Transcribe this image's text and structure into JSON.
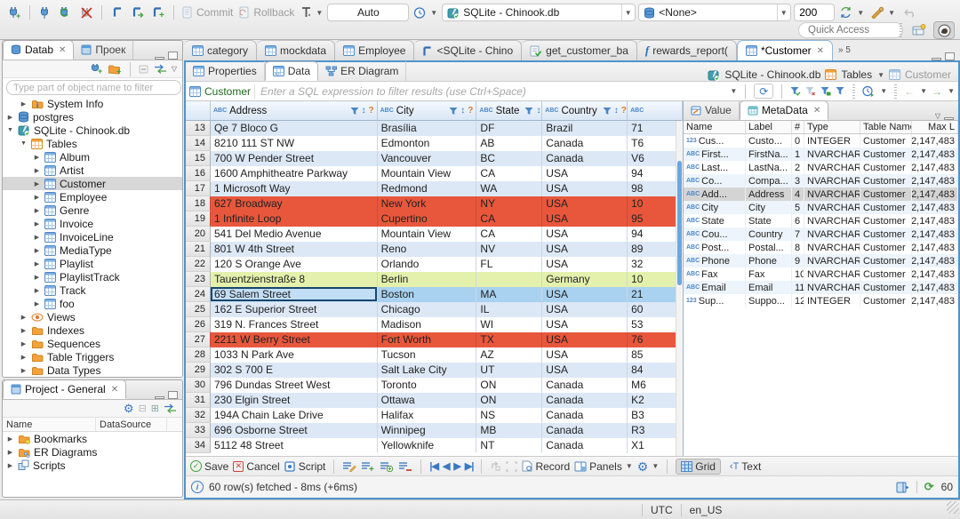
{
  "colors": {
    "accent": "#4f94cd",
    "row_alt": "#dce8f6",
    "row_error": "#e8573c",
    "row_modified": "#e4f1ad",
    "row_selected": "#a9d2f0",
    "header_blue": "#d9e7f6"
  },
  "toolbar": {
    "commit_label": "Commit",
    "rollback_label": "Rollback",
    "txn_mode": "Auto",
    "connection": "SQLite - Chinook.db",
    "schema": "<None>",
    "fetch_size": "200",
    "quick_access_placeholder": "Quick Access"
  },
  "sidebar": {
    "db_tab_label": "Datab",
    "project_tab_label": "Проек",
    "filter_placeholder": "Type part of object name to filter",
    "tree": [
      {
        "label": "System Info",
        "icon": "folder-info",
        "level": 1,
        "expand": "collapsed"
      },
      {
        "label": "postgres",
        "icon": "database",
        "level": 0,
        "expand": "collapsed"
      },
      {
        "label": "SQLite - Chinook.db",
        "icon": "sqlite-db",
        "level": 0,
        "expand": "expanded"
      },
      {
        "label": "Tables",
        "icon": "tables-folder",
        "level": 1,
        "expand": "expanded"
      },
      {
        "label": "Album",
        "icon": "table",
        "level": 2,
        "expand": "collapsed"
      },
      {
        "label": "Artist",
        "icon": "table",
        "level": 2,
        "expand": "collapsed"
      },
      {
        "label": "Customer",
        "icon": "table",
        "level": 2,
        "expand": "collapsed",
        "selected": true
      },
      {
        "label": "Employee",
        "icon": "table",
        "level": 2,
        "expand": "collapsed"
      },
      {
        "label": "Genre",
        "icon": "table",
        "level": 2,
        "expand": "collapsed"
      },
      {
        "label": "Invoice",
        "icon": "table",
        "level": 2,
        "expand": "collapsed"
      },
      {
        "label": "InvoiceLine",
        "icon": "table",
        "level": 2,
        "expand": "collapsed"
      },
      {
        "label": "MediaType",
        "icon": "table",
        "level": 2,
        "expand": "collapsed"
      },
      {
        "label": "Playlist",
        "icon": "table",
        "level": 2,
        "expand": "collapsed"
      },
      {
        "label": "PlaylistTrack",
        "icon": "table",
        "level": 2,
        "expand": "collapsed"
      },
      {
        "label": "Track",
        "icon": "table",
        "level": 2,
        "expand": "collapsed"
      },
      {
        "label": "foo",
        "icon": "table",
        "level": 2,
        "expand": "collapsed"
      },
      {
        "label": "Views",
        "icon": "views",
        "level": 1,
        "expand": "collapsed"
      },
      {
        "label": "Indexes",
        "icon": "folder",
        "level": 1,
        "expand": "collapsed"
      },
      {
        "label": "Sequences",
        "icon": "folder",
        "level": 1,
        "expand": "collapsed"
      },
      {
        "label": "Table Triggers",
        "icon": "folder",
        "level": 1,
        "expand": "collapsed"
      },
      {
        "label": "Data Types",
        "icon": "folder",
        "level": 1,
        "expand": "collapsed"
      }
    ],
    "project_panel": {
      "title": "Project - General",
      "columns": [
        "Name",
        "DataSource"
      ],
      "items": [
        {
          "label": "Bookmarks",
          "icon": "bookmarks-folder"
        },
        {
          "label": "ER Diagrams",
          "icon": "er-folder"
        },
        {
          "label": "Scripts",
          "icon": "scripts"
        }
      ]
    }
  },
  "editor": {
    "tabs": [
      {
        "label": "category",
        "icon": "table"
      },
      {
        "label": "mockdata",
        "icon": "table"
      },
      {
        "label": "Employee",
        "icon": "table"
      },
      {
        "label": "<SQLite - Chino",
        "icon": "sql"
      },
      {
        "label": "get_customer_ba",
        "icon": "script-check"
      },
      {
        "label": "rewards_report(",
        "icon": "function"
      },
      {
        "label": "*Customer",
        "icon": "table",
        "active": true,
        "closable": true
      }
    ],
    "tab_overflow": "5",
    "subtabs": [
      {
        "label": "Properties",
        "icon": "table"
      },
      {
        "label": "Data",
        "icon": "data-grid",
        "active": true
      },
      {
        "label": "ER Diagram",
        "icon": "diagram"
      }
    ],
    "breadcrumb": {
      "connection": "SQLite - Chinook.db",
      "container": "Tables",
      "entity": "Customer"
    },
    "filter": {
      "entity": "Customer",
      "placeholder": "Enter a SQL expression to filter results (use Ctrl+Space)"
    },
    "grid": {
      "columns": [
        {
          "label": "Address",
          "kind": "ABC"
        },
        {
          "label": "City",
          "kind": "ABC"
        },
        {
          "label": "State",
          "kind": "ABC"
        },
        {
          "label": "Country",
          "kind": "ABC"
        },
        {
          "label": "",
          "kind": "ABC"
        }
      ],
      "rows": [
        {
          "num": "13",
          "address": "Qe 7 Bloco G",
          "city": "Brasília",
          "state": "DF",
          "country": "Brazil",
          "postal": "71",
          "style": "alt"
        },
        {
          "num": "14",
          "address": "8210 111 ST NW",
          "city": "Edmonton",
          "state": "AB",
          "country": "Canada",
          "postal": "T6",
          "style": "plain"
        },
        {
          "num": "15",
          "address": "700 W Pender Street",
          "city": "Vancouver",
          "state": "BC",
          "country": "Canada",
          "postal": "V6",
          "style": "alt"
        },
        {
          "num": "16",
          "address": "1600 Amphitheatre Parkway",
          "city": "Mountain View",
          "state": "CA",
          "country": "USA",
          "postal": "94",
          "style": "plain"
        },
        {
          "num": "17",
          "address": "1 Microsoft Way",
          "city": "Redmond",
          "state": "WA",
          "country": "USA",
          "postal": "98",
          "style": "alt"
        },
        {
          "num": "18",
          "address": "627 Broadway",
          "city": "New York",
          "state": "NY",
          "country": "USA",
          "postal": "10",
          "style": "red"
        },
        {
          "num": "19",
          "address": "1 Infinite Loop",
          "city": "Cupertino",
          "state": "CA",
          "country": "USA",
          "postal": "95",
          "style": "red"
        },
        {
          "num": "20",
          "address": "541 Del Medio Avenue",
          "city": "Mountain View",
          "state": "CA",
          "country": "USA",
          "postal": "94",
          "style": "plain"
        },
        {
          "num": "21",
          "address": "801 W 4th Street",
          "city": "Reno",
          "state": "NV",
          "country": "USA",
          "postal": "89",
          "style": "alt"
        },
        {
          "num": "22",
          "address": "120 S Orange Ave",
          "city": "Orlando",
          "state": "FL",
          "country": "USA",
          "postal": "32",
          "style": "plain"
        },
        {
          "num": "23",
          "address": "Tauentzienstraße 8",
          "city": "Berlin",
          "state": "",
          "country": "Germany",
          "postal": "10",
          "style": "green"
        },
        {
          "num": "24",
          "address": "69 Salem Street",
          "city": "Boston",
          "state": "MA",
          "country": "USA",
          "postal": "21",
          "style": "selected"
        },
        {
          "num": "25",
          "address": "162 E Superior Street",
          "city": "Chicago",
          "state": "IL",
          "country": "USA",
          "postal": "60",
          "style": "alt"
        },
        {
          "num": "26",
          "address": "319 N. Frances Street",
          "city": "Madison",
          "state": "WI",
          "country": "USA",
          "postal": "53",
          "style": "plain"
        },
        {
          "num": "27",
          "address": "2211 W Berry Street",
          "city": "Fort Worth",
          "state": "TX",
          "country": "USA",
          "postal": "76",
          "style": "red"
        },
        {
          "num": "28",
          "address": "1033 N Park Ave",
          "city": "Tucson",
          "state": "AZ",
          "country": "USA",
          "postal": "85",
          "style": "plain"
        },
        {
          "num": "29",
          "address": "302 S 700 E",
          "city": "Salt Lake City",
          "state": "UT",
          "country": "USA",
          "postal": "84",
          "style": "alt"
        },
        {
          "num": "30",
          "address": "796 Dundas Street West",
          "city": "Toronto",
          "state": "ON",
          "country": "Canada",
          "postal": "M6",
          "style": "plain"
        },
        {
          "num": "31",
          "address": "230 Elgin Street",
          "city": "Ottawa",
          "state": "ON",
          "country": "Canada",
          "postal": "K2",
          "style": "alt"
        },
        {
          "num": "32",
          "address": "194A Chain Lake Drive",
          "city": "Halifax",
          "state": "NS",
          "country": "Canada",
          "postal": "B3",
          "style": "plain"
        },
        {
          "num": "33",
          "address": "696 Osborne Street",
          "city": "Winnipeg",
          "state": "MB",
          "country": "Canada",
          "postal": "R3",
          "style": "alt"
        },
        {
          "num": "34",
          "address": "5112 48 Street",
          "city": "Yellowknife",
          "state": "NT",
          "country": "Canada",
          "postal": "X1",
          "style": "plain"
        }
      ]
    },
    "panel": {
      "value_tab": "Value",
      "metadata_tab": "MetaData",
      "columns": [
        "Name",
        "Label",
        "#",
        "Type",
        "Table Name",
        "Max L"
      ],
      "rows": [
        {
          "kind": "123",
          "name": "Cus...",
          "label": "Custo...",
          "num": "0",
          "type": "INTEGER",
          "table": "Customer",
          "max": "2,147,483"
        },
        {
          "kind": "ABC",
          "name": "First...",
          "label": "FirstNa...",
          "num": "1",
          "type": "NVARCHAR",
          "table": "Customer",
          "max": "2,147,483"
        },
        {
          "kind": "ABC",
          "name": "Last...",
          "label": "LastNa...",
          "num": "2",
          "type": "NVARCHAR",
          "table": "Customer",
          "max": "2,147,483"
        },
        {
          "kind": "ABC",
          "name": "Co...",
          "label": "Compa...",
          "num": "3",
          "type": "NVARCHAR",
          "table": "Customer",
          "max": "2,147,483"
        },
        {
          "kind": "ABC",
          "name": "Add...",
          "label": "Address",
          "num": "4",
          "type": "NVARCHAR",
          "table": "Customer",
          "max": "2,147,483",
          "selected": true
        },
        {
          "kind": "ABC",
          "name": "City",
          "label": "City",
          "num": "5",
          "type": "NVARCHAR",
          "table": "Customer",
          "max": "2,147,483"
        },
        {
          "kind": "ABC",
          "name": "State",
          "label": "State",
          "num": "6",
          "type": "NVARCHAR",
          "table": "Customer",
          "max": "2,147,483"
        },
        {
          "kind": "ABC",
          "name": "Cou...",
          "label": "Country",
          "num": "7",
          "type": "NVARCHAR",
          "table": "Customer",
          "max": "2,147,483"
        },
        {
          "kind": "ABC",
          "name": "Post...",
          "label": "Postal...",
          "num": "8",
          "type": "NVARCHAR",
          "table": "Customer",
          "max": "2,147,483"
        },
        {
          "kind": "ABC",
          "name": "Phone",
          "label": "Phone",
          "num": "9",
          "type": "NVARCHAR",
          "table": "Customer",
          "max": "2,147,483"
        },
        {
          "kind": "ABC",
          "name": "Fax",
          "label": "Fax",
          "num": "10",
          "type": "NVARCHAR",
          "table": "Customer",
          "max": "2,147,483"
        },
        {
          "kind": "ABC",
          "name": "Email",
          "label": "Email",
          "num": "11",
          "type": "NVARCHAR",
          "table": "Customer",
          "max": "2,147,483"
        },
        {
          "kind": "123",
          "name": "Sup...",
          "label": "Suppo...",
          "num": "12",
          "type": "INTEGER",
          "table": "Customer",
          "max": "2,147,483"
        }
      ]
    },
    "bottom": {
      "save": "Save",
      "cancel": "Cancel",
      "script": "Script",
      "record": "Record",
      "panels": "Panels",
      "grid": "Grid",
      "text": "Text"
    },
    "status": {
      "message": "60 row(s) fetched - 8ms (+6ms)",
      "refresh_value": "60"
    }
  },
  "window": {
    "statusbar": {
      "timezone": "UTC",
      "locale": "en_US"
    }
  }
}
